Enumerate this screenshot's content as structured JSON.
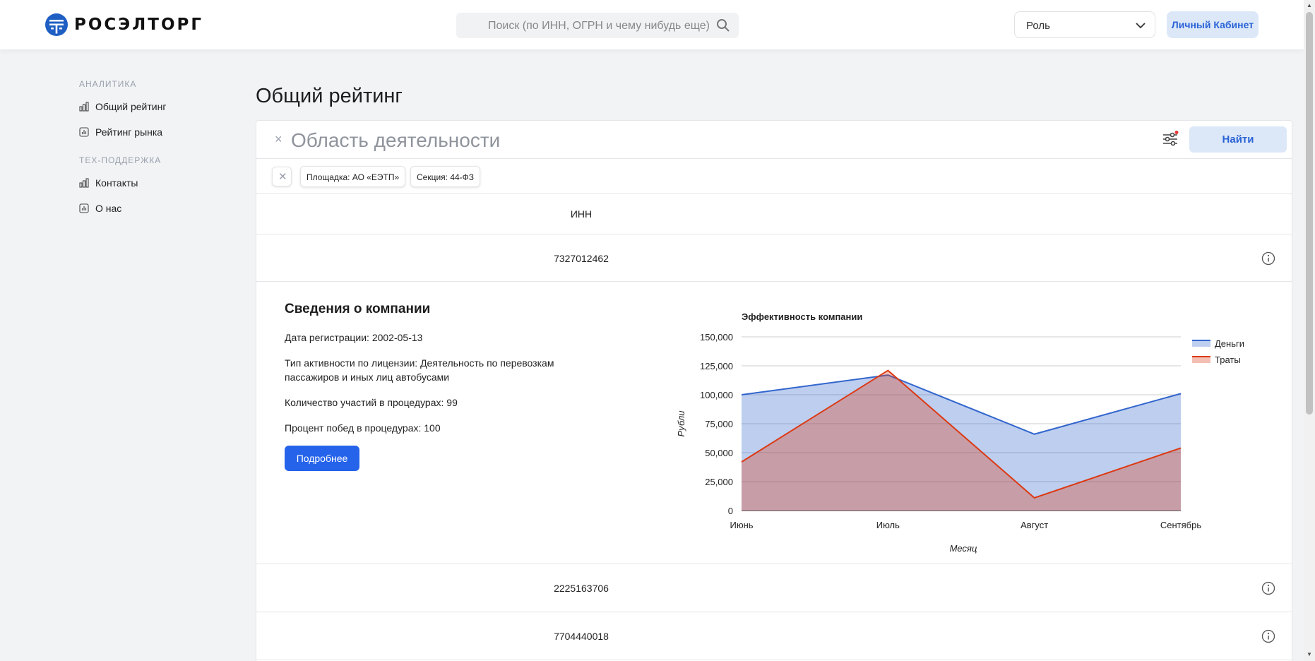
{
  "header": {
    "brand": "РОСЭЛТОРГ",
    "search_placeholder": "Поиск (по ИНН, ОГРН  и чему нибудь еще)",
    "role_label": "Роль",
    "cabinet_label": "Личный Кабинет"
  },
  "sidebar": {
    "section1": "АНАЛИТИКА",
    "items1": [
      {
        "label": "Общий рейтинг"
      },
      {
        "label": "Рейтинг рынка"
      }
    ],
    "section2": "ТЕХ-ПОДДЕРЖКА",
    "items2": [
      {
        "label": "Контакты"
      },
      {
        "label": "О нас"
      }
    ]
  },
  "main": {
    "title": "Общий рейтинг",
    "filter": {
      "close": "×",
      "placeholder": "Область деятельности",
      "find_label": "Найти"
    },
    "chips": [
      "Площадка: АО «ЕЭТП»",
      "Секция: 44-ФЗ"
    ],
    "chip_clear": "✕",
    "table": {
      "header_inn": "ИНН",
      "rows": [
        {
          "inn": "7327012462"
        },
        {
          "inn": "2225163706"
        },
        {
          "inn": "7704440018"
        }
      ]
    },
    "details": {
      "title": "Сведения о компании",
      "reg_date": "Дата регистрации: 2002-05-13",
      "activity": "Тип активности по лицензии: Деятельность по перевозкам пассажиров и иных лиц автобусами",
      "participations": "Количество участий в процедурах: 99",
      "win_percent": "Процент побед в процедурах: 100",
      "more_label": "Подробнее"
    }
  },
  "colors": {
    "accent": "#2563eb",
    "money": "#3366cc",
    "spend": "#dc3912"
  },
  "chart_data": {
    "type": "area",
    "title": "Эффективность компании",
    "xlabel": "Месяц",
    "ylabel": "Рубли",
    "categories": [
      "Июнь",
      "Июль",
      "Август",
      "Сентябрь"
    ],
    "series": [
      {
        "name": "Деньги",
        "values": [
          100000,
          117000,
          66000,
          101000
        ]
      },
      {
        "name": "Траты",
        "values": [
          42000,
          121000,
          11000,
          54000
        ]
      }
    ],
    "ylim": [
      0,
      150000
    ],
    "yticks": [
      "0",
      "25,000",
      "50,000",
      "75,000",
      "100,000",
      "125,000",
      "150,000"
    ],
    "grid": true,
    "legend": "right"
  }
}
